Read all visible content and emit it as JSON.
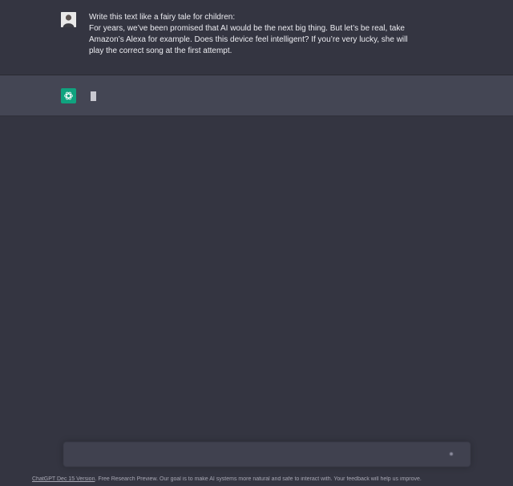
{
  "conversation": {
    "user_message": {
      "lines": [
        "Write this text like a fairy tale for children:",
        "For years, we’ve been promised that AI would be the next big thing. But let’s be real, take",
        "Amazon’s Alexa for example. Does this device feel intelligent? If you’re very lucky, she will",
        "play the correct song at the first attempt."
      ]
    },
    "assistant_message": {
      "text": "",
      "state": "generating"
    }
  },
  "input": {
    "placeholder": "",
    "value": ""
  },
  "footer": {
    "link_text": "ChatGPT Dec 15 Version",
    "text": ". Free Research Preview. Our goal is to make AI systems more natural and safe to interact with. Your feedback will help us improve."
  },
  "colors": {
    "background": "#343541",
    "assistant_row": "#444654",
    "accent_green": "#10a37f",
    "text": "#ececf1"
  },
  "icons": {
    "user_avatar": "user-avatar-photo",
    "assistant_avatar": "openai-logo-icon",
    "send": "send-icon"
  }
}
